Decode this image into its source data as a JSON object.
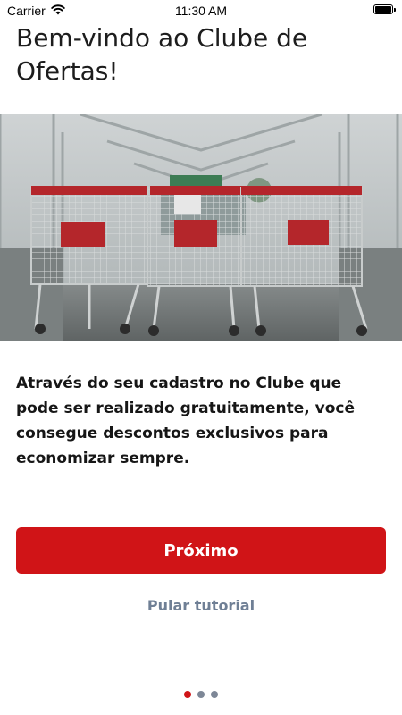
{
  "status_bar": {
    "carrier": "Carrier",
    "time": "11:30 AM",
    "wifi_icon": "wifi-icon",
    "battery_icon": "battery-icon"
  },
  "onboarding": {
    "title": "Bem-vindo ao Clube de Ofertas!",
    "hero_image": "shopping-carts-photo",
    "description": "Através do seu cadastro no Clube que pode ser realizado gratuitamente, você consegue descontos exclusivos para economizar sempre.",
    "next_label": "Próximo",
    "skip_label": "Pular tutorial",
    "pagination": {
      "total": 3,
      "active_index": 0
    }
  },
  "colors": {
    "accent": "#d01417",
    "muted_link": "#6f7f95",
    "dot_inactive": "#7d8797",
    "text": "#1d1d1d"
  }
}
